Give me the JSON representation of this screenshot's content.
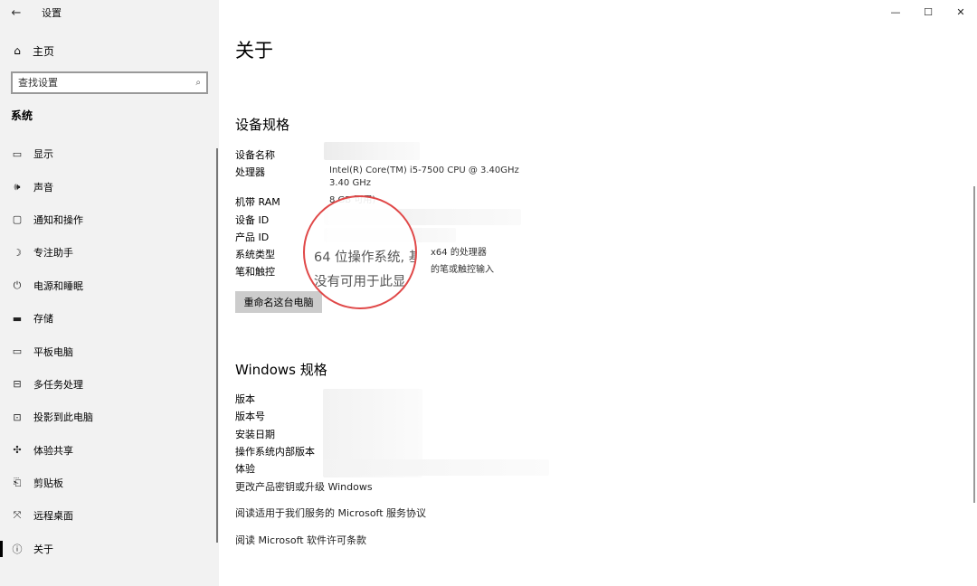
{
  "window": {
    "title": "设置",
    "minimize_glyph": "—",
    "maximize_glyph": "☐",
    "close_glyph": "✕"
  },
  "sidebar": {
    "back_glyph": "←",
    "home": {
      "icon": "⌂",
      "label": "主页"
    },
    "search": {
      "placeholder": "查找设置",
      "icon": "⌕"
    },
    "section": "系统",
    "items": [
      {
        "icon": "▭",
        "label": "显示"
      },
      {
        "icon": "🕪",
        "label": "声音"
      },
      {
        "icon": "▢",
        "label": "通知和操作"
      },
      {
        "icon": "☽",
        "label": "专注助手"
      },
      {
        "icon": "⏻",
        "label": "电源和睡眠"
      },
      {
        "icon": "▬",
        "label": "存储"
      },
      {
        "icon": "▭",
        "label": "平板电脑"
      },
      {
        "icon": "⊟",
        "label": "多任务处理"
      },
      {
        "icon": "⊡",
        "label": "投影到此电脑"
      },
      {
        "icon": "✣",
        "label": "体验共享"
      },
      {
        "icon": "⎗",
        "label": "剪贴板"
      },
      {
        "icon": "⤧",
        "label": "远程桌面"
      },
      {
        "icon": "ⓘ",
        "label": "关于"
      }
    ]
  },
  "main": {
    "title": "关于",
    "device_specs": {
      "heading": "设备规格",
      "rows": [
        {
          "key": "设备名称",
          "value": ""
        },
        {
          "key": "处理器",
          "value": "Intel(R) Core(TM) i5-7500 CPU @ 3.40GHz   3.40 GHz"
        },
        {
          "key": "机带 RAM",
          "value": "8       GB 可用)"
        },
        {
          "key": "设备 ID",
          "value": ""
        },
        {
          "key": "产品 ID",
          "value": ""
        },
        {
          "key": "系统类型",
          "value": "x64 的处理器"
        },
        {
          "key": "笔和触控",
          "value": "的笔或触控输入"
        }
      ],
      "rename_button": "重命名这台电脑"
    },
    "windows_specs": {
      "heading": "Windows 规格",
      "rows": [
        {
          "key": "版本"
        },
        {
          "key": "版本号"
        },
        {
          "key": "安装日期"
        },
        {
          "key": "操作系统内部版本"
        },
        {
          "key": "体验"
        }
      ],
      "links": [
        "更改产品密钥或升级 Windows",
        "阅读适用于我们服务的 Microsoft 服务协议",
        "阅读 Microsoft 软件许可条款"
      ]
    },
    "magnifier": {
      "line1": "64 位操作系统, 基",
      "line2": "没有可用于此显"
    }
  }
}
